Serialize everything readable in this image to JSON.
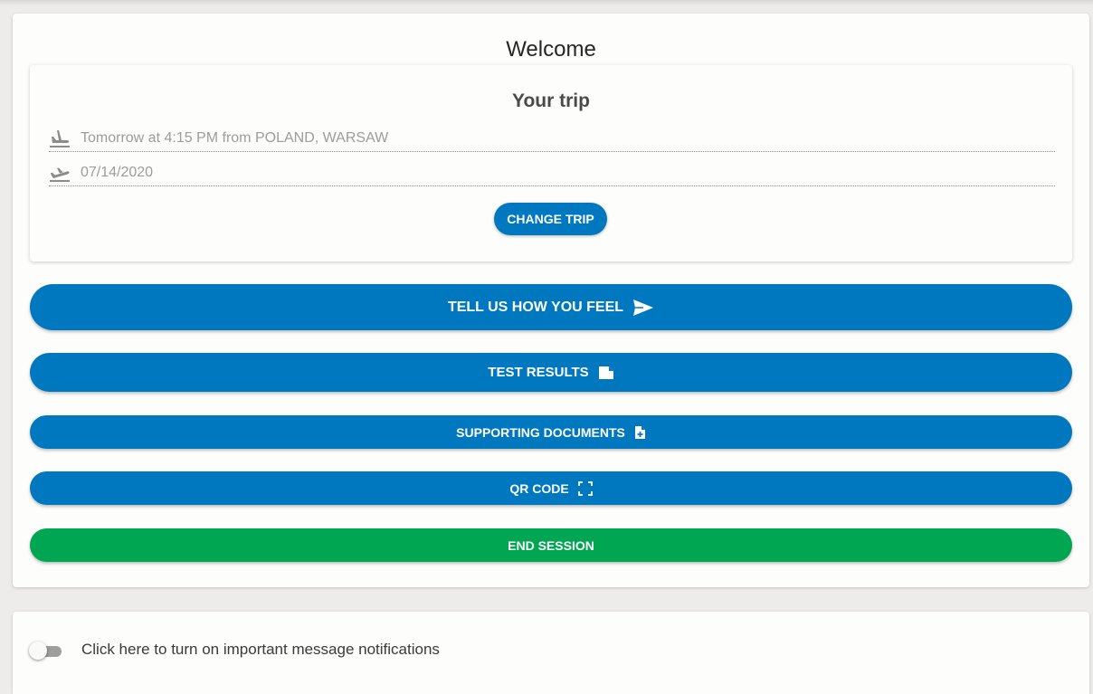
{
  "header": {
    "title": "Welcome"
  },
  "trip": {
    "title": "Your trip",
    "departure": {
      "icon": "flight-departure-icon",
      "text": "Tomorrow at 4:15 PM from POLAND, WARSAW"
    },
    "return": {
      "icon": "flight-takeoff-icon",
      "text": "07/14/2020"
    },
    "change_label": "CHANGE TRIP"
  },
  "actions": {
    "feel": {
      "label": "TELL US HOW YOU FEEL",
      "icon": "send-icon"
    },
    "test_results": {
      "label": "TEST RESULTS",
      "icon": "file-icon"
    },
    "supporting_docs": {
      "label": "SUPPORTING DOCUMENTS",
      "icon": "file-plus-icon"
    },
    "qr_code": {
      "label": "QR CODE",
      "icon": "scan-frame-icon"
    },
    "end_session": {
      "label": "END SESSION"
    }
  },
  "notifications": {
    "label": "Click here to turn on important message notifications",
    "enabled": false
  },
  "colors": {
    "primary": "#0078bf",
    "success": "#00a651",
    "background": "#eeeceb",
    "card": "#fdfdfb"
  }
}
